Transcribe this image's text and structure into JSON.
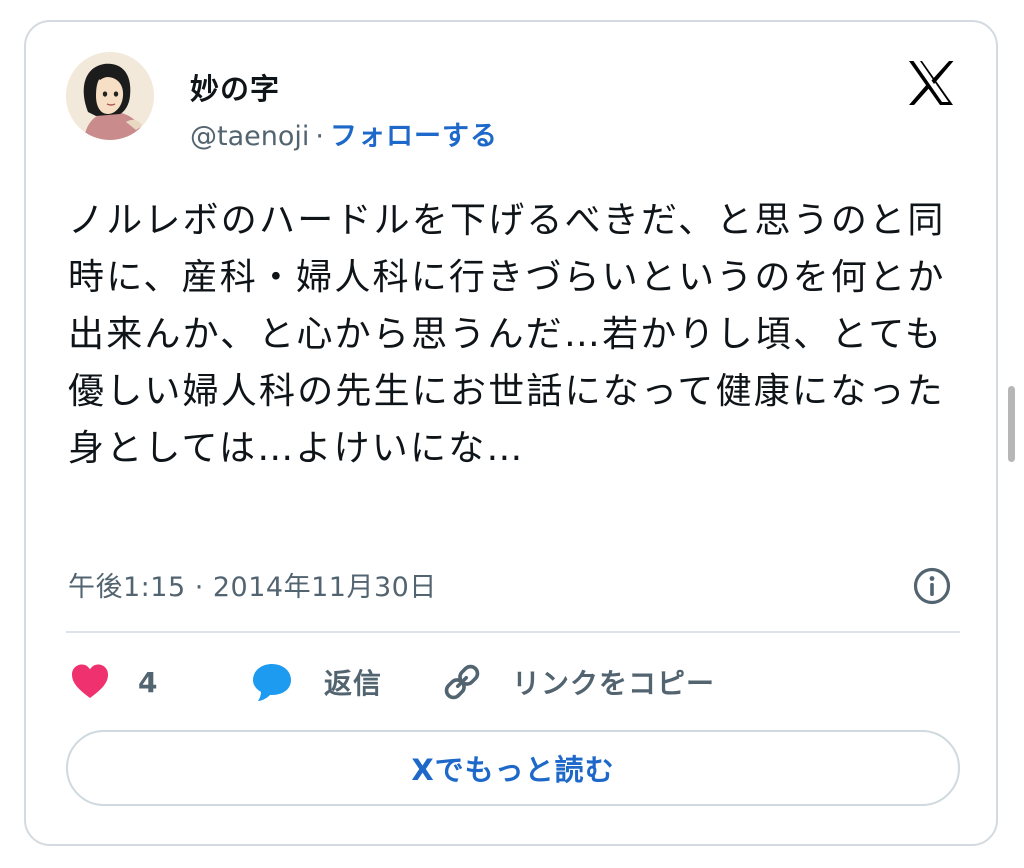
{
  "tweet": {
    "author": {
      "display_name": "妙の字",
      "handle": "@taenoji",
      "separator": "·",
      "follow_label": "フォローする"
    },
    "text": "ノルレボのハードルを下げるべきだ、と思うのと同時に、産科・婦人科に行きづらいというのを何とか出来んか、と心から思うんだ…若かりし頃、とても優しい婦人科の先生にお世話になって健康になった身としては…よけいにな…",
    "timestamp": "午後1:15 · 2014年11月30日",
    "actions": {
      "like_count": "4",
      "reply_label": "返信",
      "copy_link_label": "リンクをコピー"
    },
    "read_more_label": "Xでもっと読む"
  },
  "colors": {
    "link_blue": "#1d68c9",
    "like_pink": "#f0316f",
    "reply_blue": "#1d9bf0",
    "muted_text": "#536471",
    "border": "#d4dadf"
  },
  "icons": [
    "x-logo-icon",
    "info-icon",
    "heart-icon",
    "speech-bubble-icon",
    "link-icon"
  ]
}
